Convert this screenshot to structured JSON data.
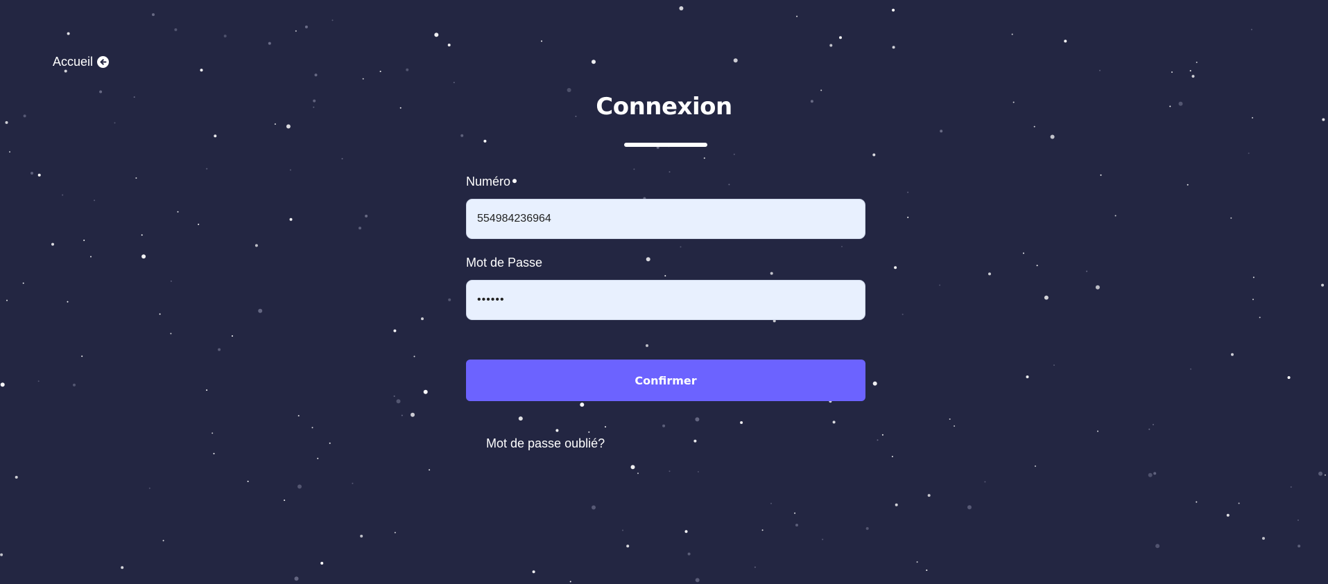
{
  "nav": {
    "home_label": "Accueil",
    "home_icon": "arrow-circle-left-icon"
  },
  "form": {
    "title": "Connexion",
    "number_label": "Numéro",
    "number_value": "554984236964",
    "password_label": "Mot de Passe",
    "password_value": "••••••",
    "submit_label": "Confirmer",
    "forgot_label": "Mot de passe oublié?"
  },
  "colors": {
    "background": "#232642",
    "accent": "#6c63ff",
    "input_background": "#e8f0fe",
    "text": "#ffffff"
  }
}
